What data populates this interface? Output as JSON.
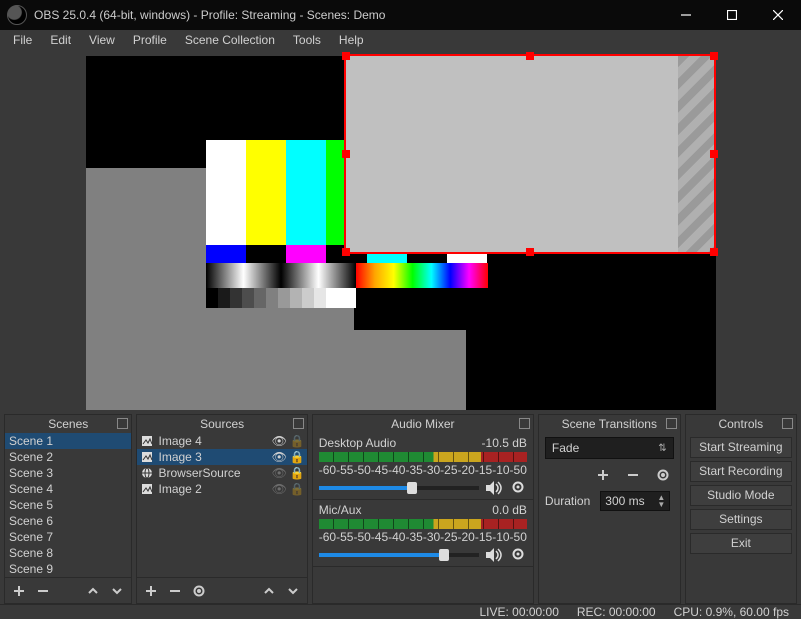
{
  "window": {
    "title": "OBS 25.0.4 (64-bit, windows) - Profile: Streaming - Scenes: Demo"
  },
  "menu": [
    "File",
    "Edit",
    "View",
    "Profile",
    "Scene Collection",
    "Tools",
    "Help"
  ],
  "panels": {
    "scenes": {
      "title": "Scenes",
      "items": [
        "Scene 1",
        "Scene 2",
        "Scene 3",
        "Scene 4",
        "Scene 5",
        "Scene 6",
        "Scene 7",
        "Scene 8",
        "Scene 9"
      ],
      "selected": 0
    },
    "sources": {
      "title": "Sources",
      "items": [
        {
          "name": "Image 4",
          "type": "image",
          "visible": true,
          "locked": false,
          "selected": false
        },
        {
          "name": "Image 3",
          "type": "image",
          "visible": true,
          "locked": true,
          "selected": true
        },
        {
          "name": "BrowserSource",
          "type": "browser",
          "visible": false,
          "locked": true,
          "selected": false
        },
        {
          "name": "Image 2",
          "type": "image",
          "visible": false,
          "locked": false,
          "selected": false
        }
      ]
    },
    "mixer": {
      "title": "Audio Mixer",
      "ticks": [
        "-60",
        "-55",
        "-50",
        "-45",
        "-40",
        "-35",
        "-30",
        "-25",
        "-20",
        "-15",
        "-10",
        "-5",
        "0"
      ],
      "tracks": [
        {
          "name": "Desktop Audio",
          "level": "-10.5 dB",
          "fill": 58
        },
        {
          "name": "Mic/Aux",
          "level": "0.0 dB",
          "fill": 78
        }
      ]
    },
    "transitions": {
      "title": "Scene Transitions",
      "selected": "Fade",
      "duration_label": "Duration",
      "duration": "300 ms"
    },
    "controls": {
      "title": "Controls",
      "buttons": [
        "Start Streaming",
        "Start Recording",
        "Studio Mode",
        "Settings",
        "Exit"
      ]
    }
  },
  "status": {
    "live": "LIVE: 00:00:00",
    "rec": "REC: 00:00:00",
    "cpu": "CPU: 0.9%, 60.00 fps"
  }
}
